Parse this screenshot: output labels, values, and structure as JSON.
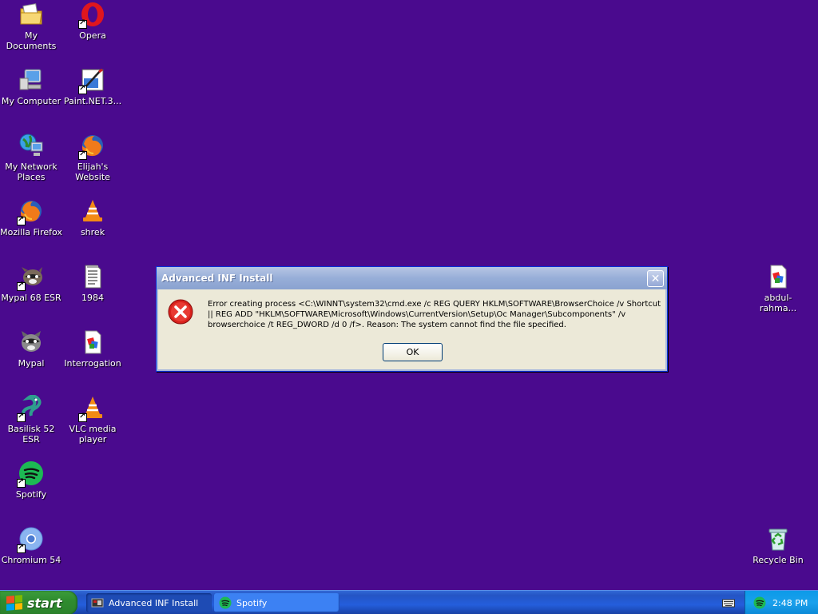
{
  "desktop": {
    "background": "#4a0a8e",
    "icons": [
      {
        "label": "My Documents",
        "icon": "folder-icon"
      },
      {
        "label": "Opera",
        "icon": "opera-icon"
      },
      {
        "label": "My Computer",
        "icon": "computer-icon"
      },
      {
        "label": "Paint.NET.3...",
        "icon": "paint-icon"
      },
      {
        "label": "My Network Places",
        "icon": "network-icon"
      },
      {
        "label": "Elijah's Website",
        "icon": "firefox-icon"
      },
      {
        "label": "Mozilla Firefox",
        "icon": "firefox-icon"
      },
      {
        "label": "shrek",
        "icon": "vlc-icon"
      },
      {
        "label": "Mypal 68 ESR",
        "icon": "mypal-icon"
      },
      {
        "label": "1984",
        "icon": "text-file-icon"
      },
      {
        "label": "Mypal",
        "icon": "mypal-icon"
      },
      {
        "label": "Interrogation",
        "icon": "image-file-icon"
      },
      {
        "label": "Basilisk 52 ESR",
        "icon": "basilisk-icon"
      },
      {
        "label": "VLC media player",
        "icon": "vlc-icon"
      },
      {
        "label": "Spotify",
        "icon": "spotify-icon"
      },
      {
        "label": "Chromium 54",
        "icon": "chromium-icon"
      },
      {
        "label": "abdul-rahma...",
        "icon": "image-file-icon"
      },
      {
        "label": "Recycle Bin",
        "icon": "recycle-bin-icon"
      }
    ]
  },
  "dialog": {
    "title": "Advanced INF Install",
    "message": "Error creating process <C:\\WINNT\\system32\\cmd.exe /c REG QUERY HKLM\\SOFTWARE\\BrowserChoice /v Shortcut || REG ADD \"HKLM\\SOFTWARE\\Microsoft\\Windows\\CurrentVersion\\Setup\\Oc Manager\\Subcomponents\" /v browserchoice /t REG_DWORD /d 0 /f>.  Reason: The system cannot find the file specified.",
    "ok_label": "OK",
    "icon": "error-icon"
  },
  "taskbar": {
    "start_label": "start",
    "tasks": [
      {
        "label": "Advanced INF Install",
        "icon": "inf-install-icon",
        "active": true
      },
      {
        "label": "Spotify",
        "icon": "spotify-icon",
        "active": false
      }
    ],
    "clock": "2:48 PM"
  }
}
